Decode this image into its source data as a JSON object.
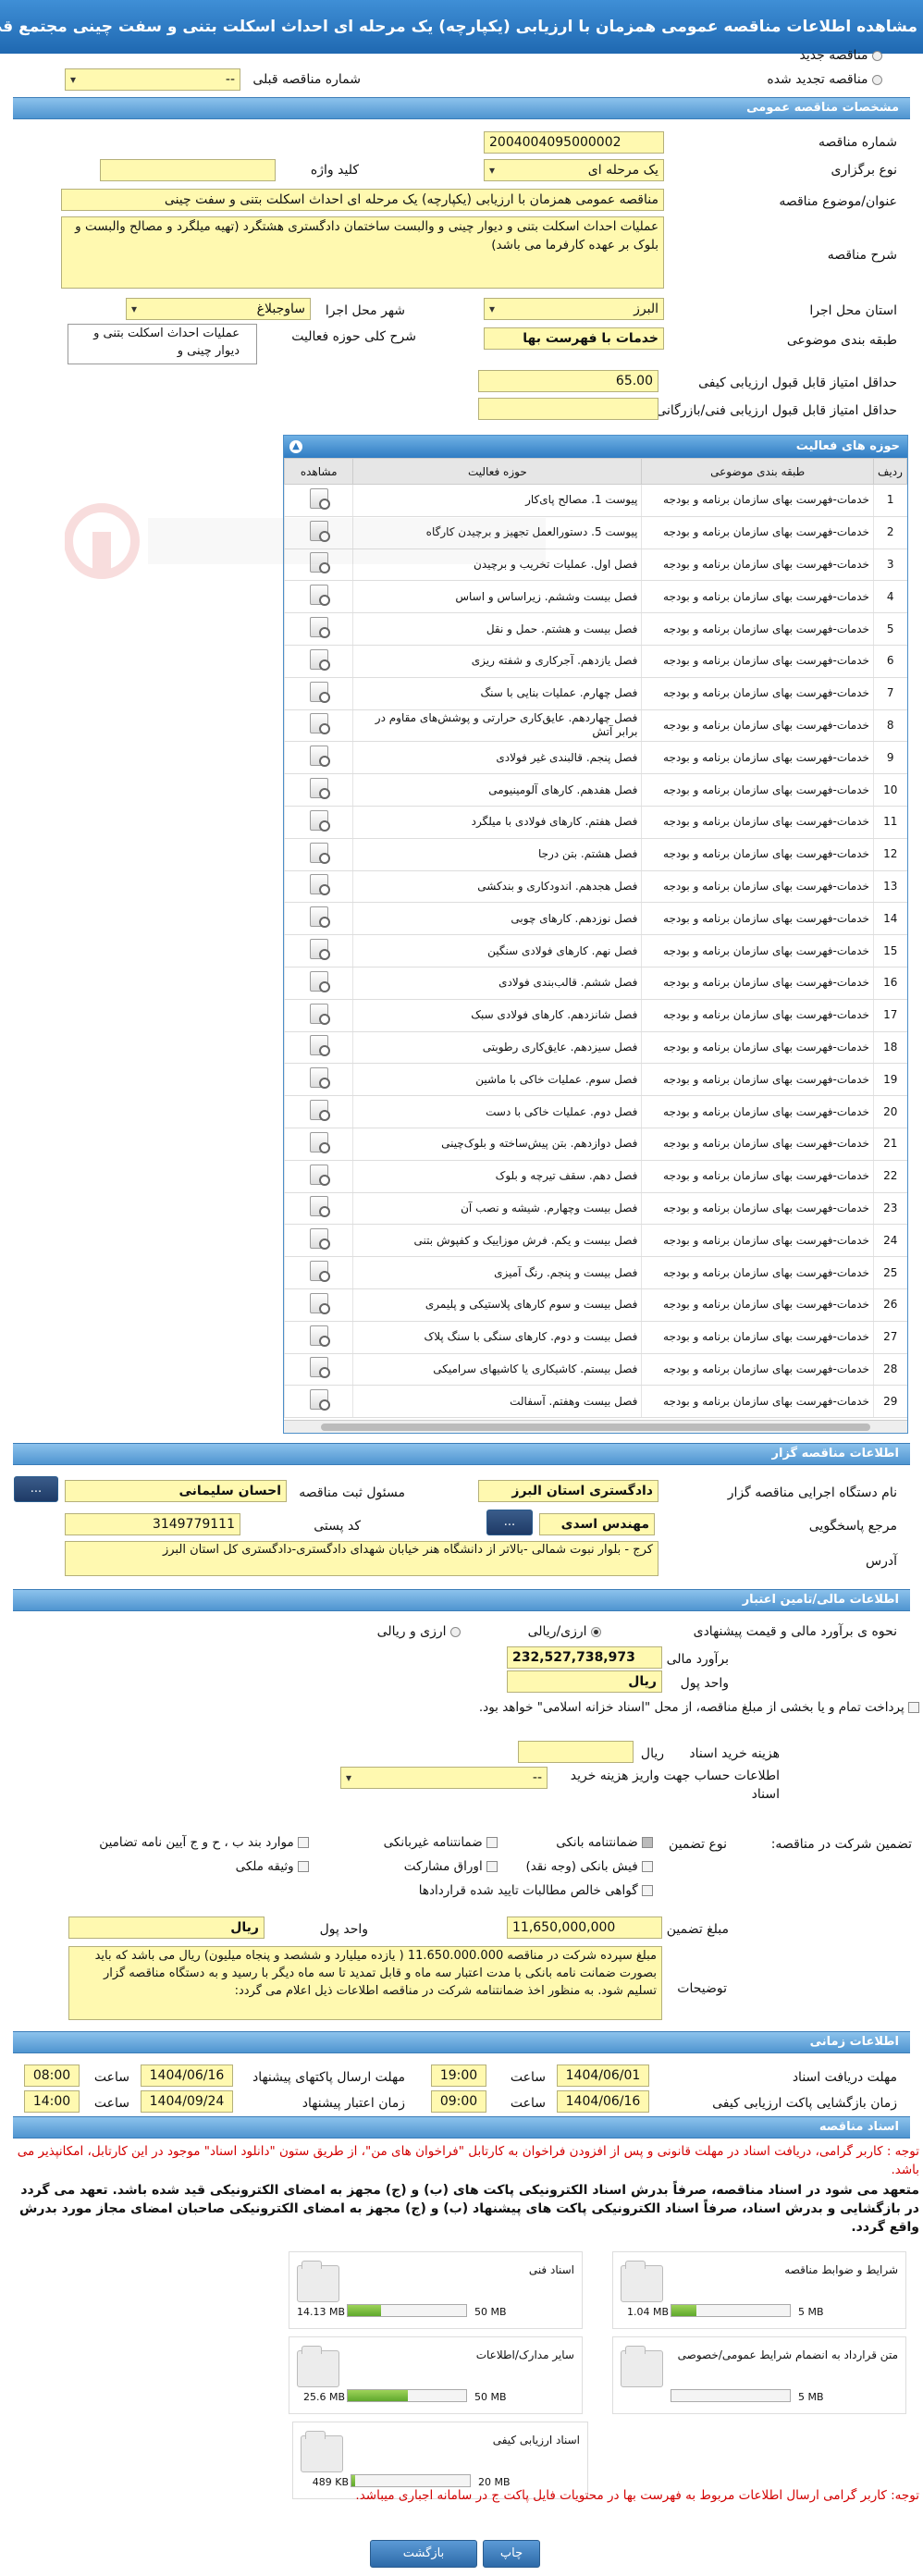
{
  "header": {
    "title": "مشاهده اطلاعات مناقصه عمومی همزمان با ارزیابی (یکپارچه) یک مرحله ای احداث اسکلت بتنی و سفت چینی مجتمع قضایی هشتگرد"
  },
  "top": {
    "new_tender": "مناقصه جدید",
    "renewed_tender": "مناقصه تجدید شده",
    "prev_number_label": "شماره مناقصه قبلی",
    "prev_number_value": "--"
  },
  "sections": {
    "general": "مشخصات مناقصه عمومی",
    "organizer": "اطلاعات مناقصه گزار",
    "financial": "اطلاعات مالی/تامین اعتبار",
    "timing": "اطلاعات زمانی",
    "documents": "اسناد مناقصه"
  },
  "general": {
    "number_label": "شماره مناقصه",
    "number_value": "2004004095000002",
    "type_label": "نوع برگزاری",
    "type_value": "یک مرحله ای",
    "keyword_label": "کلید واژه",
    "keyword_value": "",
    "title_label": "عنوان/موضوع مناقصه",
    "title_value": "مناقصه عمومی همزمان با ارزیابی (یکپارچه) یک مرحله ای احداث اسکلت بتنی و سفت چینی",
    "desc_label": "شرح مناقصه",
    "desc_value": "عملیات احداث اسکلت بتنی و دیوار چینی و والبست ساختمان دادگستری هشتگرد (تهیه میلگرد و مصالح والبست و بلوک بر عهده کارفرما می باشد)",
    "province_label": "استان محل اجرا",
    "province_value": "البرز",
    "city_label": "شهر محل اجرا",
    "city_value": "ساوجبلاغ",
    "category_label": "طبقه بندی موضوعی",
    "category_value": "خدمات با فهرست بها",
    "scope_label": "شرح کلی حوزه فعالیت",
    "scope_value": "عملیات احداث اسکلت بتنی و دیوار چینی و",
    "min_quality_label": "حداقل امتیاز قابل قبول ارزیابی کیفی",
    "min_quality_value": "65.00",
    "min_tech_label": "حداقل امتیاز قابل قبول ارزیابی فنی/بازرگانی",
    "min_tech_value": ""
  },
  "activity_grid": {
    "title": "حوزه های فعالیت",
    "headers": {
      "row": "ردیف",
      "category": "طبقه بندی موضوعی",
      "activity": "حوزه فعالیت",
      "view": "مشاهده"
    },
    "category_text": "خدمات-فهرست بهای سازمان برنامه و بودجه",
    "rows": [
      "پیوست 1. مصالح پای‌کار",
      "پیوست 5. دستورالعمل تجهیز و برچیدن کارگاه",
      "فصل اول. عملیات تخریب و برچیدن",
      "فصل بیست وششم. زیراساس و اساس",
      "فصل بیست و هشتم. حمل و نقل",
      "فصل یازدهم. آجرکاری و شفته ریزی",
      "فصل چهارم. عملیات بنایی با سنگ",
      "فصل چهاردهم. عایق‌کاری حرارتی و پوشش‌های مقاوم در برابر آتش",
      "فصل پنجم. قالبندی غیر فولادی",
      "فصل هفدهم. کارهای آلومینیومی",
      "فصل هفتم. کارهای فولادی با میلگرد",
      "فصل هشتم. بتن درجا",
      "فصل هجدهم. اندودکاری و بندکشی",
      "فصل نوزدهم. کارهای چوبی",
      "فصل نهم. کارهای فولادی سنگین",
      "فصل ششم. قالب‌بندی فولادی",
      "فصل شانزدهم. کارهای فولادی سبک",
      "فصل سیزدهم. عایق‌کاری رطوبتی",
      "فصل سوم. عملیات خاکی با ماشین",
      "فصل دوم. عملیات خاکی با دست",
      "فصل دوازدهم. بتن پیش‌ساخته و بلوک‌چینی",
      "فصل دهم. سقف تیرچه و بلوک",
      "فصل بیست وچهارم. شیشه و نصب آن",
      "فصل بیست و یکم. فرش موزاییک و کفپوش بتنی",
      "فصل بیست و پنجم. رنگ آمیزی",
      "فصل بیست و سوم کارهای پلاستیکی و پلیمری",
      "فصل بیست و دوم. کارهای سنگی با سنگ پلاک",
      "فصل بیستم. کاشیکاری یا کاشیهای سرامیکی",
      "فصل بیست وهفتم. آسفالت"
    ]
  },
  "organizer": {
    "agency_label": "نام دستگاه اجرایی مناقصه گزار",
    "agency_value": "دادگستری استان البرز",
    "registrar_label": "مسئول ثبت مناقصه",
    "registrar_value": "احسان سلیمانی",
    "responder_label": "مرجع پاسخگویی",
    "responder_value": "مهندس  اسدی",
    "postal_label": "کد پستی",
    "postal_value": "3149779111",
    "address_label": "آدرس",
    "address_value": "کرج - بلوار نبوت شمالی -بالاتر از دانشگاه هنر خیابان شهدای دادگستری-دادگستری کل استان البرز",
    "dots": "..."
  },
  "financial": {
    "method_label": "نحوه ی برآورد مالی و قیمت پیشنهادی",
    "method_rial": "ارزی/ریالی",
    "method_both": "ارزی و ریالی",
    "estimate_label": "برآورد مالی",
    "estimate_value": "232,527,738,973",
    "currency_label": "واحد پول",
    "currency_value": "ریال",
    "treasury_text": "پرداخت تمام و یا بخشی از مبلغ مناقصه، از محل \"اسناد خزانه اسلامی\" خواهد بود.",
    "doc_fee_label": "هزینه خرید اسناد",
    "doc_fee_unit": "ریال",
    "doc_fee_value": "",
    "account_label": "اطلاعات حساب جهت واریز هزینه خرید اسناد",
    "account_value": "--",
    "guarantee_type_label": "نوع تضمین",
    "guarantee_participation_label": "تضمین شرکت در مناقصه:",
    "bank_guarantee": "ضمانتنامه بانکی",
    "nonbank_guarantee": "ضمانتنامه غیربانکی",
    "article_items": "موارد بند ب ، ح و ج آیین نامه تضامین",
    "cash_receipt": "فیش بانکی (وجه نقد)",
    "bonds": "اوراق مشارکت",
    "property_bond": "وثیقه ملکی",
    "net_claims": "گواهی خالص مطالبات تایید شده قراردادها",
    "guarantee_amount_label": "مبلغ تضمین",
    "guarantee_amount_value": "11,650,000,000",
    "guarantee_currency_label": "واحد پول",
    "guarantee_currency_value": "ریال",
    "notes_label": "توضیحات",
    "notes_value": "مبلغ سپرده شرکت در مناقصه 11.650.000.000 ( یازده میلیارد و ششصد و پنجاه میلیون) ریال می باشد که باید بصورت ضمانت نامه بانکی با مدت اعتبار سه ماه و قابل تمدید تا سه ماه دیگر با رسید و به دستگاه مناقصه گزار تسلیم شود. به منظور اخذ ضمانتنامه شرکت در مناقصه اطلاعات ذیل اعلام می گردد:"
  },
  "timing": {
    "receive_deadline_label": "مهلت دریافت اسناد",
    "receive_deadline_date": "1404/06/01",
    "receive_deadline_time": "19:00",
    "submit_deadline_label": "مهلت ارسال پاکتهای پیشنهاد",
    "submit_deadline_date": "1404/06/16",
    "submit_deadline_time": "08:00",
    "quality_open_label": "زمان بازگشایی پاکت ارزیابی کیفی",
    "quality_open_date": "1404/06/16",
    "quality_open_time": "09:00",
    "validity_label": "زمان اعتبار پیشنهاد",
    "validity_date": "1404/09/24",
    "validity_time": "14:00",
    "time_label": "ساعت"
  },
  "documents": {
    "notice1": "توجه : کاربر گرامی، دریافت اسناد در مهلت قانونی و پس از افزودن فراخوان به کارتابل \"فراخوان های من\"، از طریق ستون \"دانلود اسناد\" موجود در این کارتابل، امکانپذیر می باشد.",
    "notice2": "متعهد می شود در اسناد مناقصه، صرفاً بدرش اسناد الکترونیکی پاکت های (ب) و (ج) مجهز به امضای الکترونیکی قید شده باشد. تعهد می گردد در بازگشایی و بدرش اسناد، صرفاً اسناد الکترونیکی پاکت های پیشنهاد (ب) و (ج) مجهز به امضای الکترونیکی صاحبان امضای مجاز مورد بدرش واقع گردد.",
    "tiles": [
      {
        "name": "شرایط و ضوابط مناقصه",
        "current": "1.04 MB",
        "max": "5 MB",
        "ratio": 0.21
      },
      {
        "name": "اسناد فنی",
        "current": "14.13 MB",
        "max": "50 MB",
        "ratio": 0.28
      },
      {
        "name": "متن قرارداد به انضمام شرایط عمومی/خصوصی",
        "current": "",
        "max": "5 MB",
        "ratio": 0
      },
      {
        "name": "سایر مدارک/اطلاعات",
        "current": "25.6 MB",
        "max": "50 MB",
        "ratio": 0.51
      },
      {
        "name": "اسناد ارزیابی کیفی",
        "current": "489 KB",
        "max": "20 MB",
        "ratio": 0.03
      }
    ],
    "notice3": "توجه: کاربر گرامی ارسال اطلاعات مربوط به فهرست بها در محتویات فایل پاکت ج در سامانه اجباری میباشد."
  },
  "footer": {
    "print": "چاپ",
    "back": "بازگشت"
  },
  "colors": {
    "header": "#1f68b1",
    "field": "#fff9b0",
    "section": "#4f95d0",
    "notice": "#d20000"
  }
}
